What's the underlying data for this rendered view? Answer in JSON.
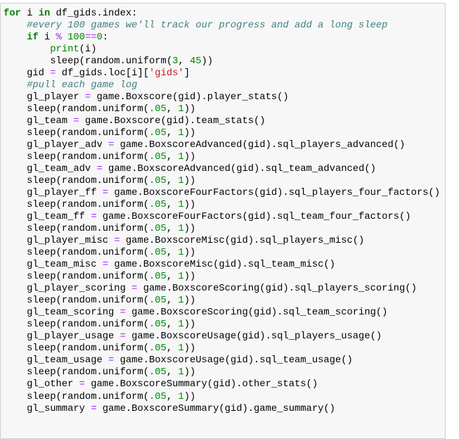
{
  "cell": {
    "type": "code",
    "language": "python",
    "lines": [
      [
        [
          "kw",
          "for"
        ],
        [
          "tx",
          " i "
        ],
        [
          "kw",
          "in"
        ],
        [
          "tx",
          " df_gids.index:"
        ]
      ],
      [
        [
          "tx",
          "    "
        ],
        [
          "cm",
          "#every 100 games we'll track our progress and add a long sleep"
        ]
      ],
      [
        [
          "tx",
          "    "
        ],
        [
          "kw",
          "if"
        ],
        [
          "tx",
          " i "
        ],
        [
          "op",
          "%"
        ],
        [
          "tx",
          " "
        ],
        [
          "nu",
          "100"
        ],
        [
          "op",
          "=="
        ],
        [
          "nu",
          "0"
        ],
        [
          "tx",
          ":"
        ]
      ],
      [
        [
          "tx",
          "        "
        ],
        [
          "bi",
          "print"
        ],
        [
          "tx",
          "(i)"
        ]
      ],
      [
        [
          "tx",
          "        sleep(random.uniform("
        ],
        [
          "nu",
          "3"
        ],
        [
          "tx",
          ", "
        ],
        [
          "nu",
          "45"
        ],
        [
          "tx",
          "))"
        ]
      ],
      [
        [
          "tx",
          "    gid "
        ],
        [
          "op",
          "="
        ],
        [
          "tx",
          " df_gids.loc[i]["
        ],
        [
          "st",
          "'gids'"
        ],
        [
          "tx",
          "]"
        ]
      ],
      [
        [
          "tx",
          "    "
        ],
        [
          "cm",
          "#pull each game log"
        ]
      ],
      [
        [
          "tx",
          "    gl_player "
        ],
        [
          "op",
          "="
        ],
        [
          "tx",
          " game.Boxscore(gid).player_stats()"
        ]
      ],
      [
        [
          "tx",
          "    sleep(random.uniform("
        ],
        [
          "nu",
          ".05"
        ],
        [
          "tx",
          ", "
        ],
        [
          "nu",
          "1"
        ],
        [
          "tx",
          "))"
        ]
      ],
      [
        [
          "tx",
          "    gl_team "
        ],
        [
          "op",
          "="
        ],
        [
          "tx",
          " game.Boxscore(gid).team_stats()"
        ]
      ],
      [
        [
          "tx",
          "    sleep(random.uniform("
        ],
        [
          "nu",
          ".05"
        ],
        [
          "tx",
          ", "
        ],
        [
          "nu",
          "1"
        ],
        [
          "tx",
          "))"
        ]
      ],
      [
        [
          "tx",
          "    gl_player_adv "
        ],
        [
          "op",
          "="
        ],
        [
          "tx",
          " game.BoxscoreAdvanced(gid).sql_players_advanced()"
        ]
      ],
      [
        [
          "tx",
          "    sleep(random.uniform("
        ],
        [
          "nu",
          ".05"
        ],
        [
          "tx",
          ", "
        ],
        [
          "nu",
          "1"
        ],
        [
          "tx",
          "))"
        ]
      ],
      [
        [
          "tx",
          "    gl_team_adv "
        ],
        [
          "op",
          "="
        ],
        [
          "tx",
          " game.BoxscoreAdvanced(gid).sql_team_advanced()"
        ]
      ],
      [
        [
          "tx",
          "    sleep(random.uniform("
        ],
        [
          "nu",
          ".05"
        ],
        [
          "tx",
          ", "
        ],
        [
          "nu",
          "1"
        ],
        [
          "tx",
          "))"
        ]
      ],
      [
        [
          "tx",
          "    gl_player_ff "
        ],
        [
          "op",
          "="
        ],
        [
          "tx",
          " game.BoxscoreFourFactors(gid).sql_players_four_factors()"
        ]
      ],
      [
        [
          "tx",
          "    sleep(random.uniform("
        ],
        [
          "nu",
          ".05"
        ],
        [
          "tx",
          ", "
        ],
        [
          "nu",
          "1"
        ],
        [
          "tx",
          "))"
        ]
      ],
      [
        [
          "tx",
          "    gl_team_ff "
        ],
        [
          "op",
          "="
        ],
        [
          "tx",
          " game.BoxscoreFourFactors(gid).sql_team_four_factors()"
        ]
      ],
      [
        [
          "tx",
          "    sleep(random.uniform("
        ],
        [
          "nu",
          ".05"
        ],
        [
          "tx",
          ", "
        ],
        [
          "nu",
          "1"
        ],
        [
          "tx",
          "))"
        ]
      ],
      [
        [
          "tx",
          "    gl_player_misc "
        ],
        [
          "op",
          "="
        ],
        [
          "tx",
          " game.BoxscoreMisc(gid).sql_players_misc()"
        ]
      ],
      [
        [
          "tx",
          "    sleep(random.uniform("
        ],
        [
          "nu",
          ".05"
        ],
        [
          "tx",
          ", "
        ],
        [
          "nu",
          "1"
        ],
        [
          "tx",
          "))"
        ]
      ],
      [
        [
          "tx",
          "    gl_team_misc "
        ],
        [
          "op",
          "="
        ],
        [
          "tx",
          " game.BoxscoreMisc(gid).sql_team_misc()"
        ]
      ],
      [
        [
          "tx",
          "    sleep(random.uniform("
        ],
        [
          "nu",
          ".05"
        ],
        [
          "tx",
          ", "
        ],
        [
          "nu",
          "1"
        ],
        [
          "tx",
          "))"
        ]
      ],
      [
        [
          "tx",
          "    gl_player_scoring "
        ],
        [
          "op",
          "="
        ],
        [
          "tx",
          " game.BoxscoreScoring(gid).sql_players_scoring()"
        ]
      ],
      [
        [
          "tx",
          "    sleep(random.uniform("
        ],
        [
          "nu",
          ".05"
        ],
        [
          "tx",
          ", "
        ],
        [
          "nu",
          "1"
        ],
        [
          "tx",
          "))"
        ]
      ],
      [
        [
          "tx",
          "    gl_team_scoring "
        ],
        [
          "op",
          "="
        ],
        [
          "tx",
          " game.BoxscoreScoring(gid).sql_team_scoring()"
        ]
      ],
      [
        [
          "tx",
          "    sleep(random.uniform("
        ],
        [
          "nu",
          ".05"
        ],
        [
          "tx",
          ", "
        ],
        [
          "nu",
          "1"
        ],
        [
          "tx",
          "))"
        ]
      ],
      [
        [
          "tx",
          "    gl_player_usage "
        ],
        [
          "op",
          "="
        ],
        [
          "tx",
          " game.BoxscoreUsage(gid).sql_players_usage()"
        ]
      ],
      [
        [
          "tx",
          "    sleep(random.uniform("
        ],
        [
          "nu",
          ".05"
        ],
        [
          "tx",
          ", "
        ],
        [
          "nu",
          "1"
        ],
        [
          "tx",
          "))"
        ]
      ],
      [
        [
          "tx",
          "    gl_team_usage "
        ],
        [
          "op",
          "="
        ],
        [
          "tx",
          " game.BoxscoreUsage(gid).sql_team_usage()"
        ]
      ],
      [
        [
          "tx",
          "    sleep(random.uniform("
        ],
        [
          "nu",
          ".05"
        ],
        [
          "tx",
          ", "
        ],
        [
          "nu",
          "1"
        ],
        [
          "tx",
          "))"
        ]
      ],
      [
        [
          "tx",
          "    gl_other "
        ],
        [
          "op",
          "="
        ],
        [
          "tx",
          " game.BoxscoreSummary(gid).other_stats()"
        ]
      ],
      [
        [
          "tx",
          "    sleep(random.uniform("
        ],
        [
          "nu",
          ".05"
        ],
        [
          "tx",
          ", "
        ],
        [
          "nu",
          "1"
        ],
        [
          "tx",
          "))"
        ]
      ],
      [
        [
          "tx",
          "    gl_summary "
        ],
        [
          "op",
          "="
        ],
        [
          "tx",
          " game.BoxscoreSummary(gid).game_summary()"
        ]
      ]
    ]
  },
  "syntax_colors": {
    "keyword": "#008000",
    "comment": "#408080",
    "operator": "#AA22FF",
    "number": "#008800",
    "string": "#BA2121",
    "builtin": "#008000",
    "text": "#000000",
    "cell_background": "#f7f7f7",
    "cell_border": "#cfcfcf"
  }
}
